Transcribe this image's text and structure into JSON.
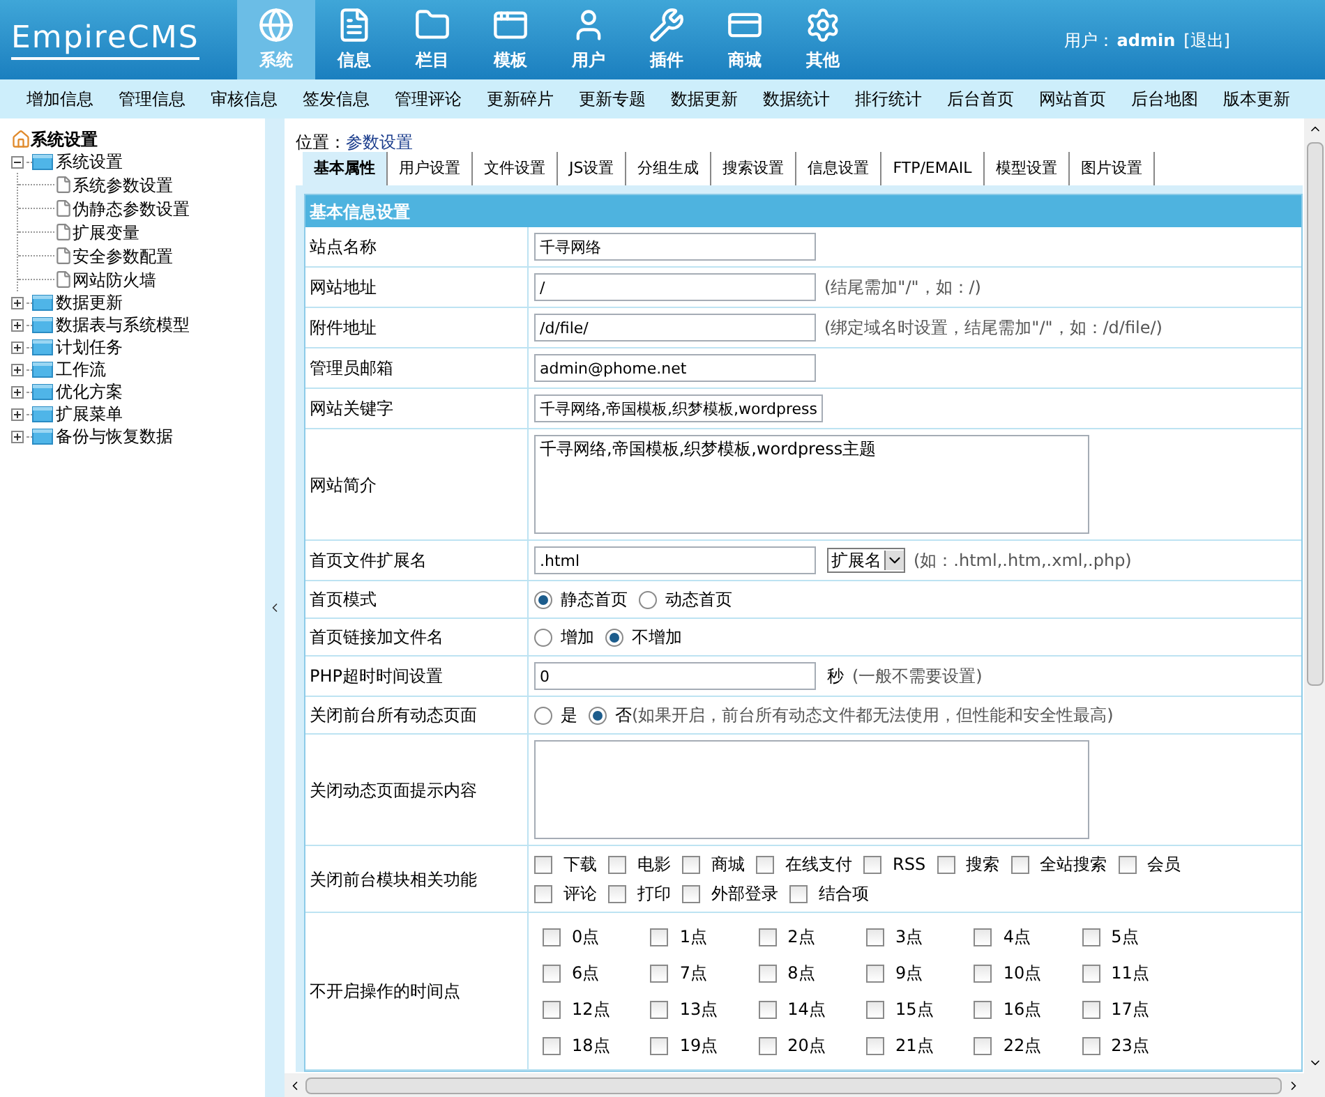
{
  "header": {
    "logo": "EmpireCMS",
    "nav": [
      {
        "label": "系统",
        "selected": true
      },
      {
        "label": "信息",
        "selected": false
      },
      {
        "label": "栏目",
        "selected": false
      },
      {
        "label": "模板",
        "selected": false
      },
      {
        "label": "用户",
        "selected": false
      },
      {
        "label": "插件",
        "selected": false
      },
      {
        "label": "商城",
        "selected": false
      },
      {
        "label": "其他",
        "selected": false
      }
    ],
    "user_label": "用户：",
    "user_name": "admin",
    "logout": "[退出]"
  },
  "menu_bar": [
    "增加信息",
    "管理信息",
    "审核信息",
    "签发信息",
    "管理评论",
    "更新碎片",
    "更新专题",
    "数据更新",
    "数据统计",
    "排行统计",
    "后台首页",
    "网站首页",
    "后台地图",
    "版本更新"
  ],
  "sidebar": {
    "title": "系统设置",
    "items": [
      {
        "label": "系统设置",
        "expanded": true,
        "children": [
          {
            "label": "系统参数设置"
          },
          {
            "label": "伪静态参数设置"
          },
          {
            "label": "扩展变量"
          },
          {
            "label": "安全参数配置"
          },
          {
            "label": "网站防火墙"
          }
        ]
      },
      {
        "label": "数据更新",
        "expanded": false
      },
      {
        "label": "数据表与系统模型",
        "expanded": false
      },
      {
        "label": "计划任务",
        "expanded": false
      },
      {
        "label": "工作流",
        "expanded": false
      },
      {
        "label": "优化方案",
        "expanded": false
      },
      {
        "label": "扩展菜单",
        "expanded": false
      },
      {
        "label": "备份与恢复数据",
        "expanded": false
      }
    ]
  },
  "breadcrumb": {
    "label": "位置：",
    "link": "参数设置"
  },
  "tabs": [
    {
      "label": "基本属性",
      "selected": true
    },
    {
      "label": "用户设置",
      "selected": false
    },
    {
      "label": "文件设置",
      "selected": false
    },
    {
      "label": "JS设置",
      "selected": false
    },
    {
      "label": "分组生成",
      "selected": false
    },
    {
      "label": "搜索设置",
      "selected": false
    },
    {
      "label": "信息设置",
      "selected": false
    },
    {
      "label": "FTP/EMAIL",
      "selected": false
    },
    {
      "label": "模型设置",
      "selected": false
    },
    {
      "label": "图片设置",
      "selected": false
    }
  ],
  "section_title": "基本信息设置",
  "rows": [
    {
      "kind": "text",
      "label": "站点名称",
      "value": "千寻网络"
    },
    {
      "kind": "text",
      "label": "网站地址",
      "value": "/",
      "hint": "(结尾需加\"/\"，如：/)"
    },
    {
      "kind": "text",
      "label": "附件地址",
      "value": "/d/file/",
      "hint": "(绑定域名时设置，结尾需加\"/\"，如：/d/file/)"
    },
    {
      "kind": "text",
      "label": "管理员邮箱",
      "value": "admin@phome.net"
    },
    {
      "kind": "text",
      "label": "网站关键字",
      "value": "千寻网络,帝国模板,织梦模板,wordpress"
    },
    {
      "kind": "textarea",
      "label": "网站简介",
      "value": "千寻网络,帝国模板,织梦模板,wordpress主题"
    },
    {
      "kind": "select",
      "label": "首页文件扩展名",
      "value": ".html",
      "select": "扩展名",
      "hint": "(如：.html,.htm,.xml,.php)"
    },
    {
      "kind": "radio",
      "label": "首页模式",
      "options": [
        {
          "label": "静态首页",
          "selected": true
        },
        {
          "label": "动态首页",
          "selected": false
        }
      ]
    },
    {
      "kind": "radio",
      "label": "首页链接加文件名",
      "options": [
        {
          "label": "增加",
          "selected": false
        },
        {
          "label": "不增加",
          "selected": true
        }
      ]
    },
    {
      "kind": "text",
      "label": "PHP超时时间设置",
      "value": "0",
      "unit": "秒",
      "hint": "(一般不需要设置)"
    },
    {
      "kind": "radio",
      "label": "关闭前台所有动态页面",
      "options": [
        {
          "label": "是",
          "selected": false
        },
        {
          "label": "否",
          "selected": true
        }
      ],
      "hint": "(如果开启，前台所有动态文件都无法使用，但性能和安全性最高)"
    },
    {
      "kind": "textarea",
      "label": "关闭动态页面提示内容",
      "value": ""
    },
    {
      "kind": "checks",
      "label": "关闭前台模块相关功能",
      "options": [
        {
          "label": "下载",
          "checked": false
        },
        {
          "label": "电影",
          "checked": false
        },
        {
          "label": "商城",
          "checked": false
        },
        {
          "label": "在线支付",
          "checked": false
        },
        {
          "label": "RSS",
          "checked": false
        },
        {
          "label": "搜索",
          "checked": false
        },
        {
          "label": "全站搜索",
          "checked": false
        },
        {
          "label": "会员",
          "checked": false
        },
        {
          "label": "评论",
          "checked": false
        },
        {
          "label": "打印",
          "checked": false
        },
        {
          "label": "外部登录",
          "checked": false
        },
        {
          "label": "结合项",
          "checked": false
        }
      ]
    },
    {
      "kind": "grid",
      "label": "不开启操作的时间点",
      "options": [
        {
          "label": "0点",
          "checked": false
        },
        {
          "label": "1点",
          "checked": false
        },
        {
          "label": "2点",
          "checked": false
        },
        {
          "label": "3点",
          "checked": false
        },
        {
          "label": "4点",
          "checked": false
        },
        {
          "label": "5点",
          "checked": false
        },
        {
          "label": "6点",
          "checked": false
        },
        {
          "label": "7点",
          "checked": false
        },
        {
          "label": "8点",
          "checked": false
        },
        {
          "label": "9点",
          "checked": false
        },
        {
          "label": "10点",
          "checked": false
        },
        {
          "label": "11点",
          "checked": false
        },
        {
          "label": "12点",
          "checked": false
        },
        {
          "label": "13点",
          "checked": false
        },
        {
          "label": "14点",
          "checked": false
        },
        {
          "label": "15点",
          "checked": false
        },
        {
          "label": "16点",
          "checked": false
        },
        {
          "label": "17点",
          "checked": false
        },
        {
          "label": "18点",
          "checked": false
        },
        {
          "label": "19点",
          "checked": false
        },
        {
          "label": "20点",
          "checked": false
        },
        {
          "label": "21点",
          "checked": false
        },
        {
          "label": "22点",
          "checked": false
        },
        {
          "label": "23点",
          "checked": false
        }
      ]
    }
  ]
}
